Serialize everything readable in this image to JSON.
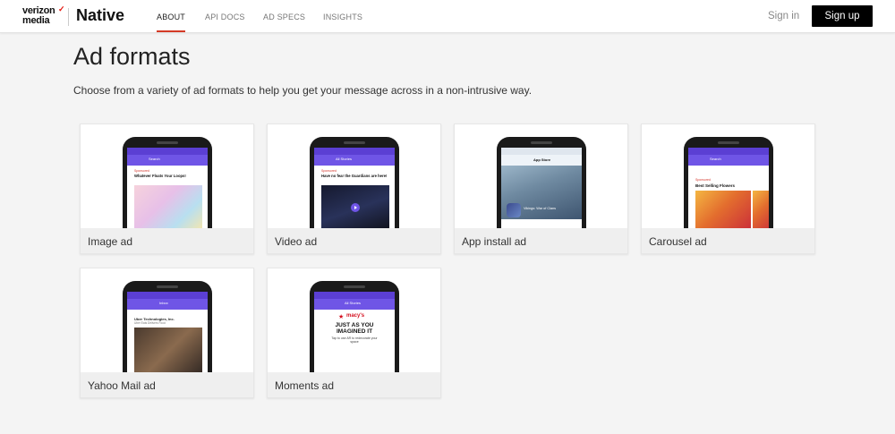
{
  "header": {
    "logo_line1": "verizon",
    "logo_line2": "media",
    "logo_mark": "✓",
    "brand": "Native",
    "nav": [
      {
        "label": "ABOUT",
        "active": true
      },
      {
        "label": "API DOCS",
        "active": false
      },
      {
        "label": "AD SPECS",
        "active": false
      },
      {
        "label": "INSIGHTS",
        "active": false
      }
    ],
    "signin_label": "Sign in",
    "signup_label": "Sign up"
  },
  "main": {
    "title": "Ad formats",
    "description": "Choose from a variety of ad formats to help you get your message across in a non-intrusive way.",
    "cards": [
      {
        "label": "Image ad",
        "screen": {
          "app": "Search",
          "sponsored": "Sponsored",
          "headline": "Whatever Floats Your Loops!"
        }
      },
      {
        "label": "Video ad",
        "screen": {
          "app": "All Stories",
          "sponsored": "Sponsored",
          "headline": "Have no fear the Guardians are here!"
        }
      },
      {
        "label": "App install ad",
        "screen": {
          "app": "App Store",
          "name": "Vikings: War of Clans"
        }
      },
      {
        "label": "Carousel ad",
        "screen": {
          "app": "Search",
          "sponsored": "Sponsored",
          "headline": "Best Selling Flowers"
        }
      },
      {
        "label": "Yahoo Mail ad",
        "screen": {
          "app": "Inbox",
          "sender": "Uber Technologies, Inc.",
          "sub": "Uber Eats Delivers Food"
        }
      },
      {
        "label": "Moments ad",
        "screen": {
          "app": "All Stories",
          "brand": "macy's",
          "headline": "JUST AS YOU IMAGINED IT",
          "sub": "Tap to use AR to redecorate your space"
        }
      }
    ]
  },
  "colors": {
    "accent_underline": "#d43a26",
    "signup_bg": "#000000",
    "phone_ui": "#6f55e6"
  }
}
